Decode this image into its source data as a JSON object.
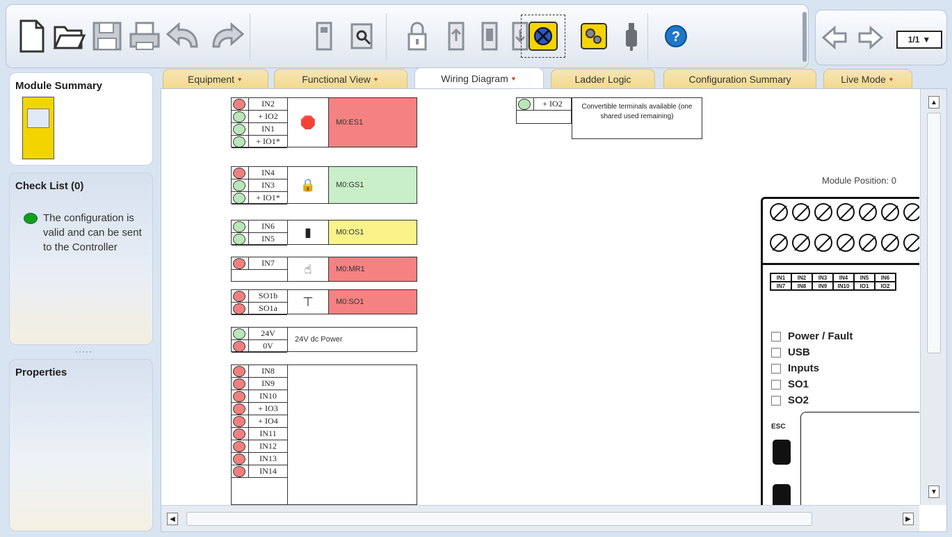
{
  "toolbar": {
    "buttons": [
      "new-icon",
      "open-icon",
      "save-icon",
      "print-icon",
      "undo-icon",
      "redo-icon",
      "connect-icon",
      "verify-icon",
      "lock-icon",
      "download-icon",
      "upload-icon",
      "validate-icon",
      "configure-icon",
      "usb-icon",
      "help-icon"
    ],
    "page": "1/1"
  },
  "module_summary": {
    "title": "Module Summary"
  },
  "check_list": {
    "title": "Check List (0)",
    "status": "The configuration is valid and can be sent to the Controller"
  },
  "properties": {
    "title": "Properties"
  },
  "tabs": [
    {
      "label": "Equipment",
      "active": false,
      "mark": true
    },
    {
      "label": "Functional View",
      "active": false,
      "mark": true
    },
    {
      "label": "Wiring Diagram",
      "active": true,
      "mark": true
    },
    {
      "label": "Ladder Logic",
      "active": false,
      "mark": false
    },
    {
      "label": "Configuration Summary",
      "active": false,
      "mark": false
    },
    {
      "label": "Live Mode",
      "active": false,
      "mark": true
    }
  ],
  "wiring": {
    "blocks": [
      {
        "name": "M0:ES1",
        "color": "#f48282",
        "terminals": [
          [
            "IN2",
            "red"
          ],
          [
            "+ IO2",
            "green"
          ],
          [
            "IN1",
            "green"
          ],
          [
            "+ IO1*",
            "green"
          ]
        ]
      },
      {
        "name": "M0:GS1",
        "color": "#c8efc8",
        "terminals": [
          [
            "IN4",
            "red"
          ],
          [
            "IN3",
            "green"
          ],
          [
            "+ IO1*",
            "green"
          ]
        ]
      },
      {
        "name": "M0:OS1",
        "color": "#f9f38a",
        "terminals": [
          [
            "IN6",
            "green"
          ],
          [
            "IN5",
            "green"
          ]
        ]
      },
      {
        "name": "M0:MR1",
        "color": "#f48282",
        "terminals": [
          [
            "IN7",
            "red"
          ]
        ]
      },
      {
        "name": "M0:SO1",
        "color": "#f48282",
        "terminals": [
          [
            "SO1b",
            "red"
          ],
          [
            "SO1a",
            "red"
          ]
        ]
      },
      {
        "name": "24V dc Power",
        "color": "#ffffff",
        "terminals": [
          [
            "24V",
            "green"
          ],
          [
            "0V",
            "red"
          ]
        ]
      },
      {
        "name": "",
        "color": "#ffffff",
        "terminals": [
          [
            "IN8",
            "red"
          ],
          [
            "IN9",
            "red"
          ],
          [
            "IN10",
            "red"
          ],
          [
            "+ IO3",
            "red"
          ],
          [
            "+ IO4",
            "red"
          ],
          [
            "IN11",
            "red"
          ],
          [
            "IN12",
            "red"
          ],
          [
            "IN13",
            "red"
          ],
          [
            "IN14",
            "red"
          ]
        ]
      }
    ],
    "convertible": {
      "terminal": "+ IO2",
      "note": "Convertible terminals available (one shared used remaining)"
    }
  },
  "device": {
    "module_position": "Module Position: 0",
    "io_row1": [
      "IN1",
      "IN2",
      "IN3",
      "IN4",
      "IN5",
      "IN6"
    ],
    "io_row2": [
      "IN7",
      "IN8",
      "IN9",
      "IN10",
      "IO1",
      "IO2"
    ],
    "leds": [
      "Power / Fault",
      "USB",
      "Inputs",
      "SO1",
      "SO2"
    ],
    "esc": "ESC"
  }
}
